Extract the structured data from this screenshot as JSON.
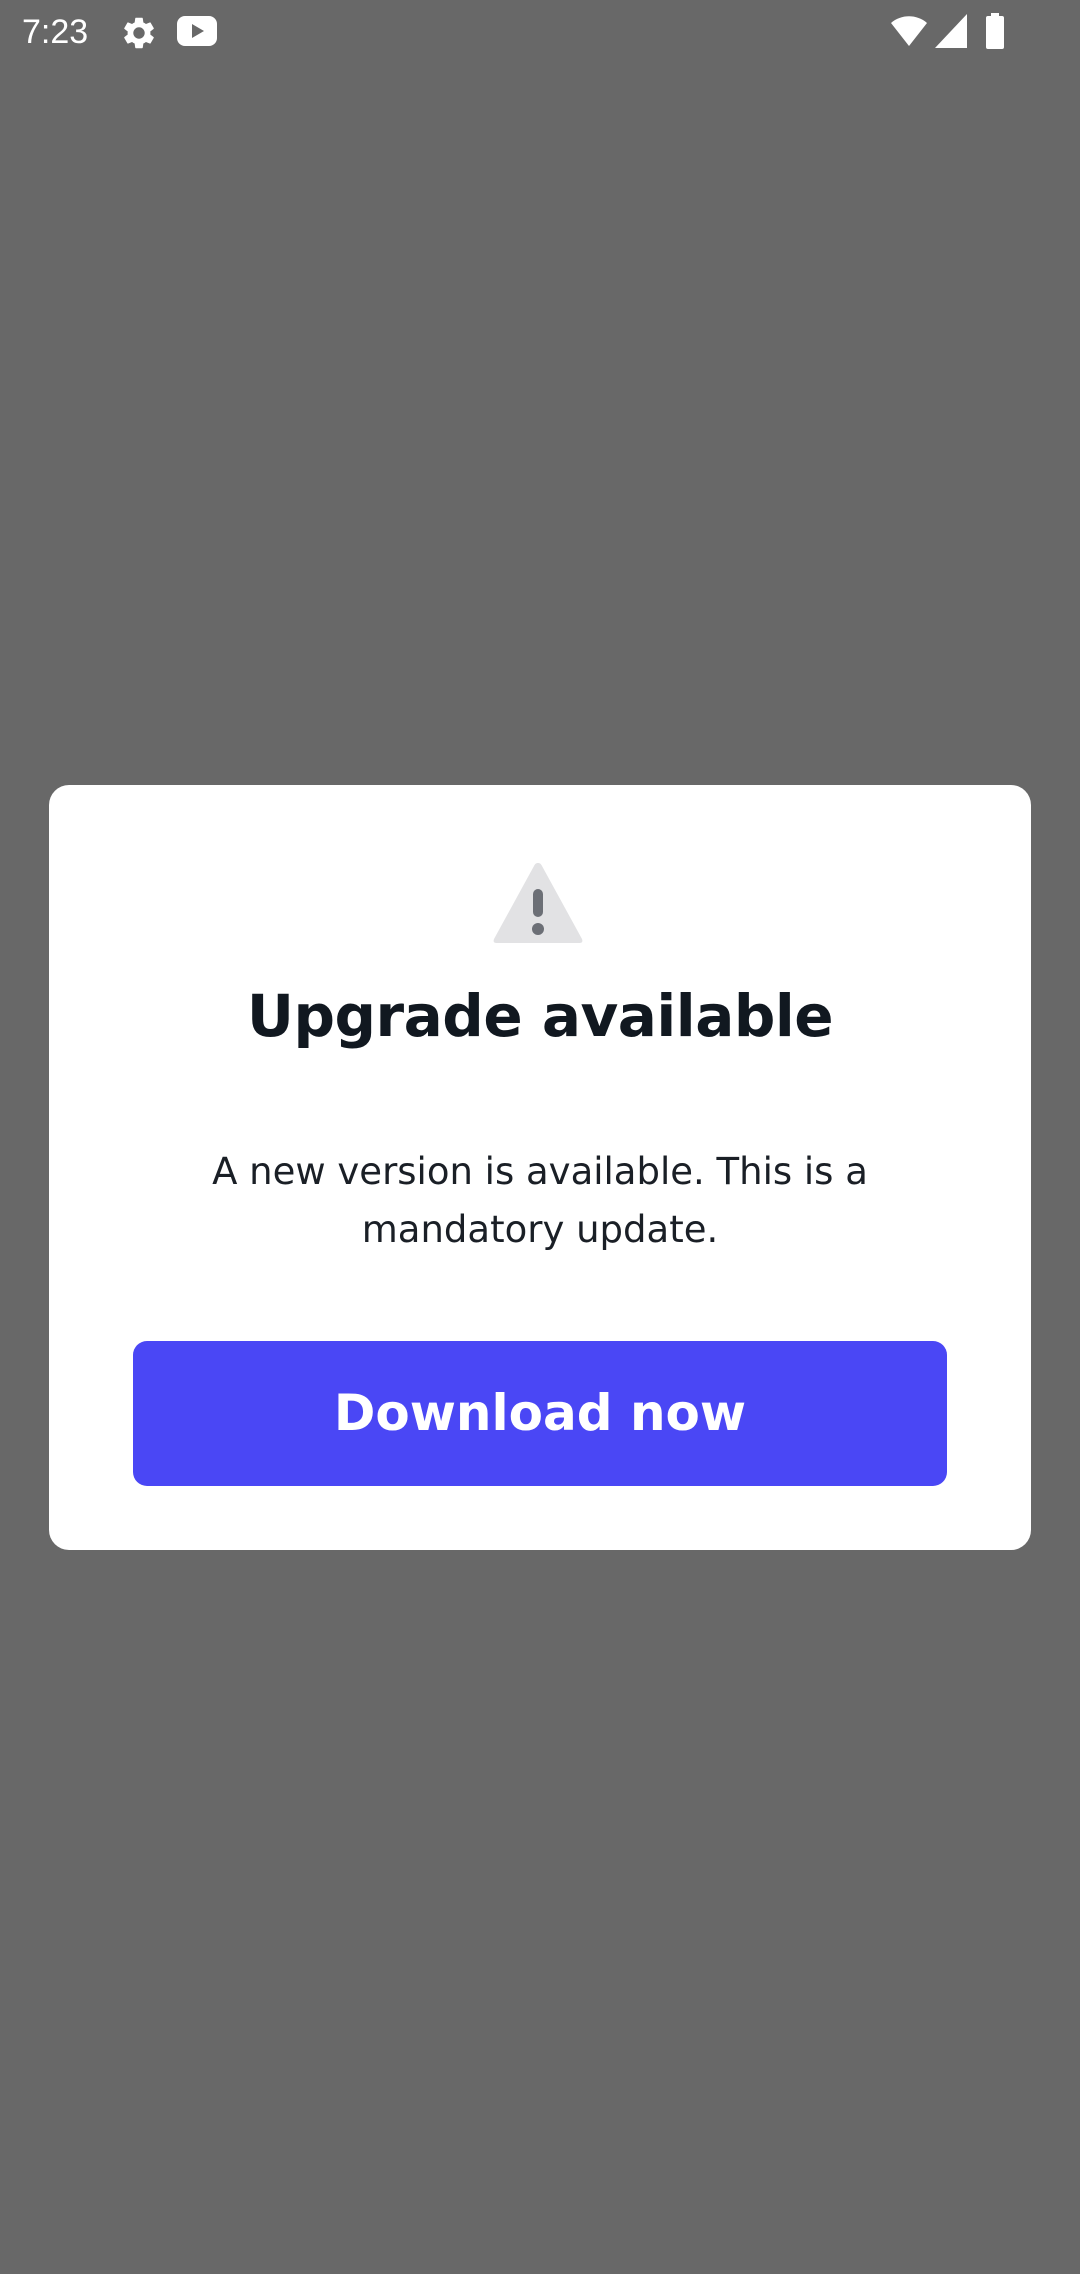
{
  "status_bar": {
    "time": "7:23",
    "icons": [
      "settings-icon",
      "youtube-icon",
      "wifi-icon",
      "signal-icon",
      "battery-icon"
    ]
  },
  "dialog": {
    "icon": "warning-icon",
    "title": "Upgrade available",
    "message": "A new version is available. This is a mandatory update.",
    "button_label": "Download now"
  },
  "colors": {
    "backdrop": "#686868",
    "dialog_background": "#ffffff",
    "button": "#4a47f5",
    "button_text": "#ffffff",
    "title_text": "#111820",
    "warning_icon": "#e2e2e4",
    "warning_mark": "#6c6f76"
  }
}
